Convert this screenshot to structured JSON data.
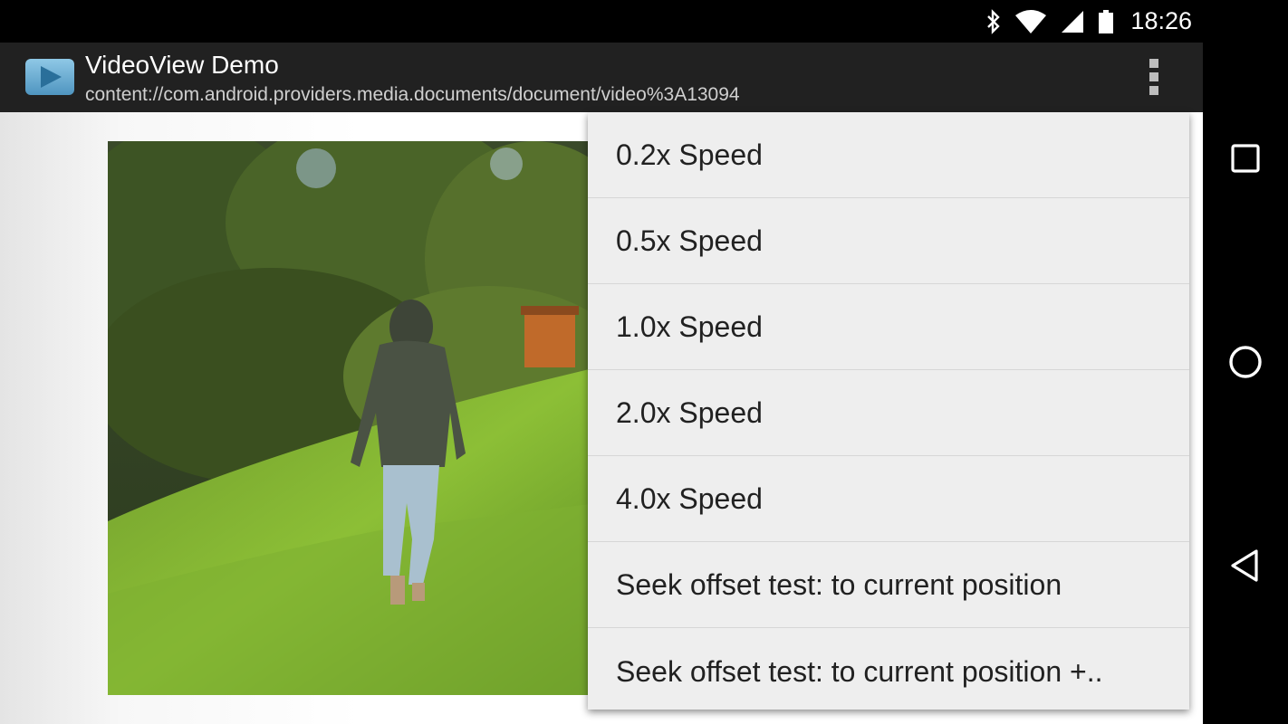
{
  "status_bar": {
    "time": "18:26",
    "icons": [
      "bluetooth-icon",
      "wifi-icon",
      "cell-signal-icon",
      "battery-icon"
    ]
  },
  "action_bar": {
    "title": "VideoView Demo",
    "subtitle": "content://com.android.providers.media.documents/document/video%3A13094",
    "app_icon": "play-icon",
    "overflow_icon": "overflow-menu-icon"
  },
  "video": {
    "description_icon": "video-frame"
  },
  "menu": {
    "items": [
      {
        "label": "0.2x Speed"
      },
      {
        "label": "0.5x Speed"
      },
      {
        "label": "1.0x Speed"
      },
      {
        "label": "2.0x Speed"
      },
      {
        "label": "4.0x Speed"
      },
      {
        "label": "Seek offset test: to current position"
      },
      {
        "label": "Seek offset test: to current position +.."
      }
    ]
  },
  "nav_bar": {
    "buttons": [
      "recents-icon",
      "home-icon",
      "back-icon"
    ]
  },
  "colors": {
    "action_bar": "#212121",
    "menu_bg": "#eeeeee",
    "status_bar": "#000000"
  }
}
